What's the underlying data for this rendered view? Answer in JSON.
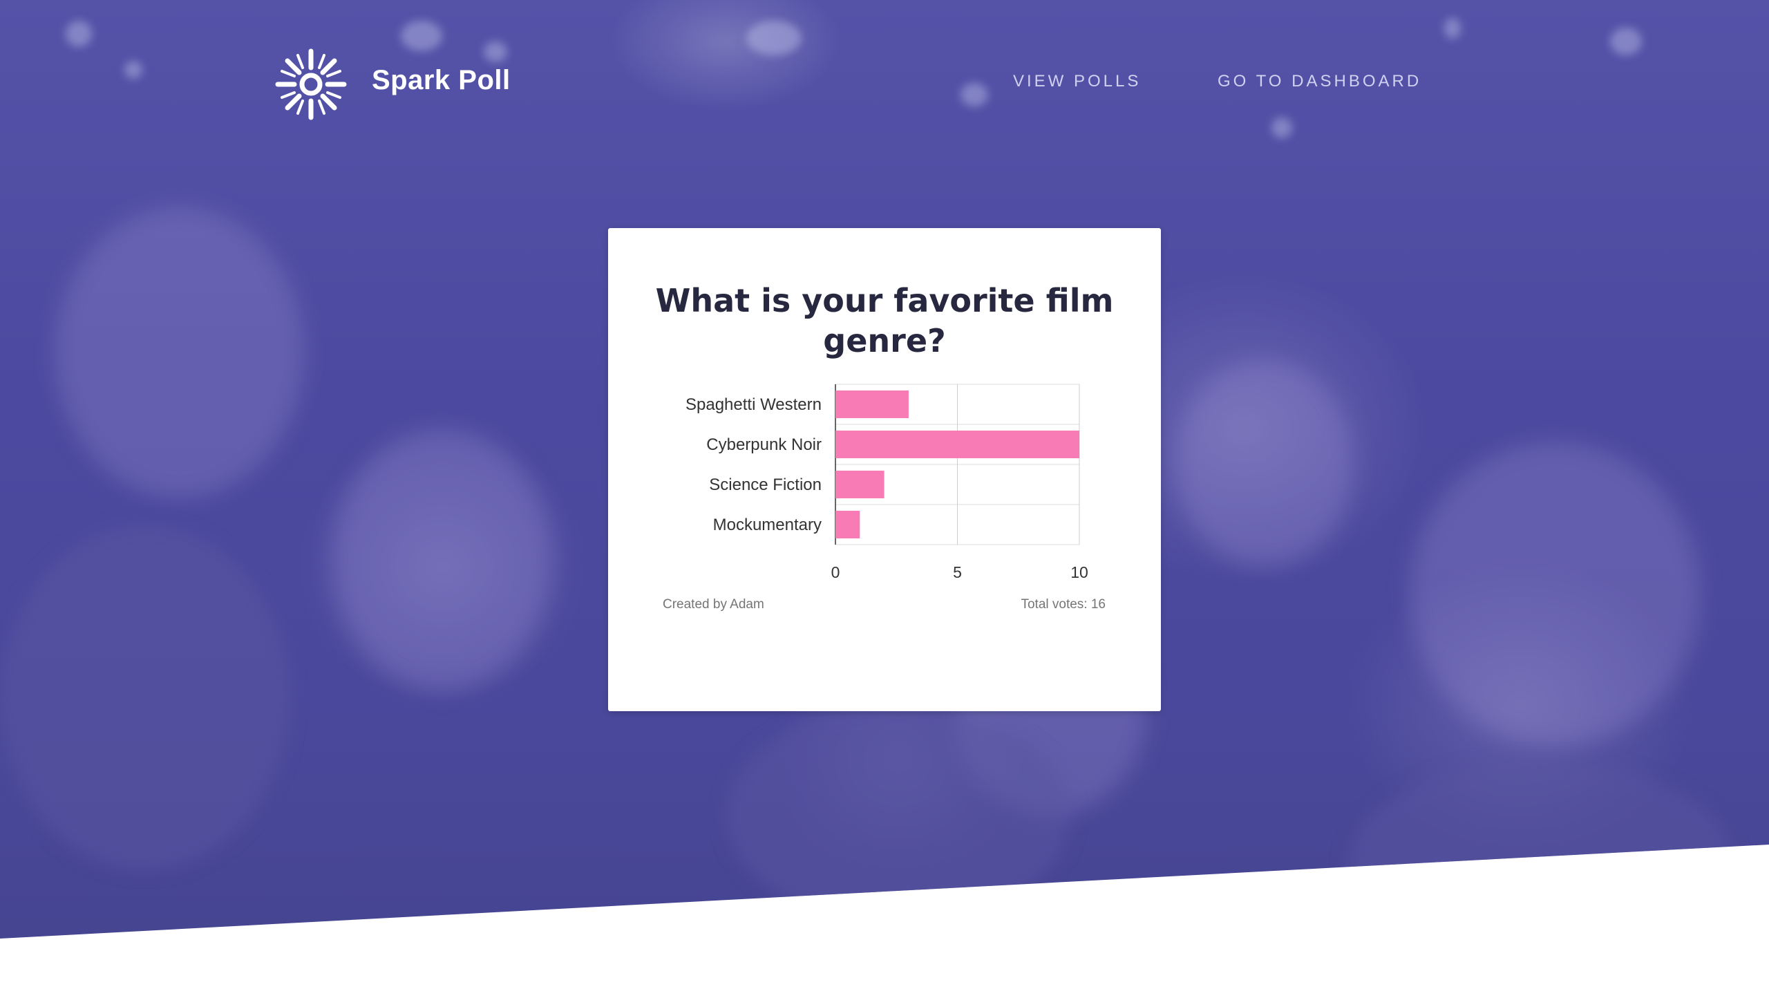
{
  "brand": {
    "name": "Spark Poll",
    "logo_icon": "sun-icon"
  },
  "nav": {
    "links": [
      {
        "label": "VIEW POLLS"
      },
      {
        "label": "GO TO DASHBOARD"
      }
    ]
  },
  "poll": {
    "question": "What is your favorite film genre?",
    "created_by": "Created by Adam",
    "total_votes": "Total votes: 16"
  },
  "colors": {
    "hero": "#4c4aa0",
    "bar": "#f97bb6",
    "title": "#27283f"
  },
  "chart_data": {
    "type": "bar",
    "orientation": "horizontal",
    "categories": [
      "Spaghetti Western",
      "Cyberpunk Noir",
      "Science Fiction",
      "Mockumentary"
    ],
    "values": [
      3,
      10,
      2,
      1
    ],
    "ticks": [
      0,
      5,
      10
    ],
    "xlim": [
      0,
      10
    ],
    "grid": true,
    "legend": "none"
  }
}
